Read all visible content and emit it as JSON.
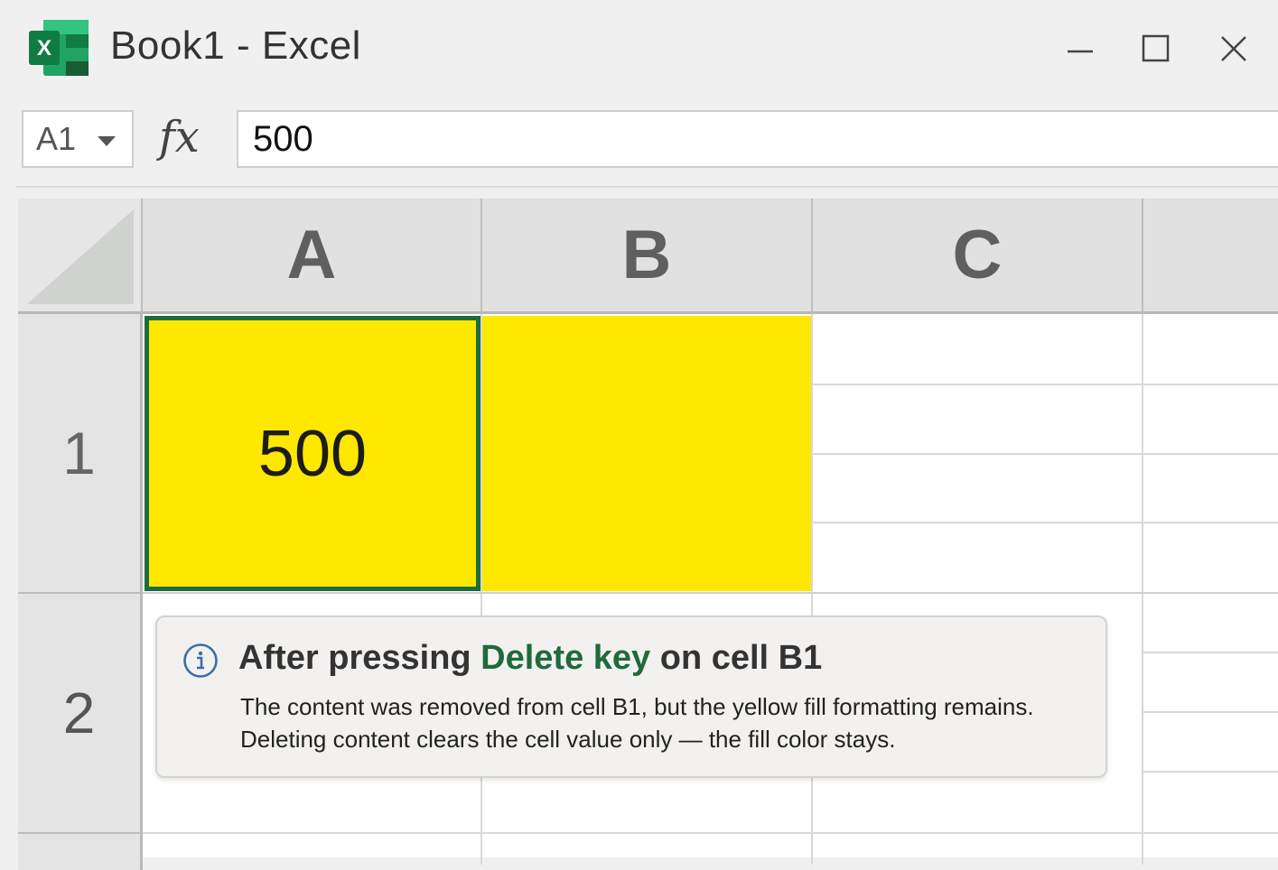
{
  "window": {
    "title": "Book1 - Excel",
    "app_icon": "excel-logo-icon",
    "controls": [
      "minimize-icon",
      "maximize-icon",
      "close-icon"
    ]
  },
  "formula_bar": {
    "name_box": "A1",
    "fx_label": "fx",
    "value": "500"
  },
  "sheet": {
    "columns": [
      "A",
      "B",
      "C"
    ],
    "rows": [
      "1",
      "2"
    ],
    "cells": {
      "A1": "500",
      "B1": ""
    },
    "fill_color": "#FFE800",
    "selection_color": "#1E6B3C"
  },
  "callout": {
    "icon": "info-icon",
    "title_pre": "After pressing ",
    "title_highlight": "Delete key",
    "title_post": " on cell B1",
    "line1": "The content was removed from cell B1, but the yellow fill formatting remains.",
    "line2": "Deleting content clears the cell value only — the fill color stays."
  }
}
